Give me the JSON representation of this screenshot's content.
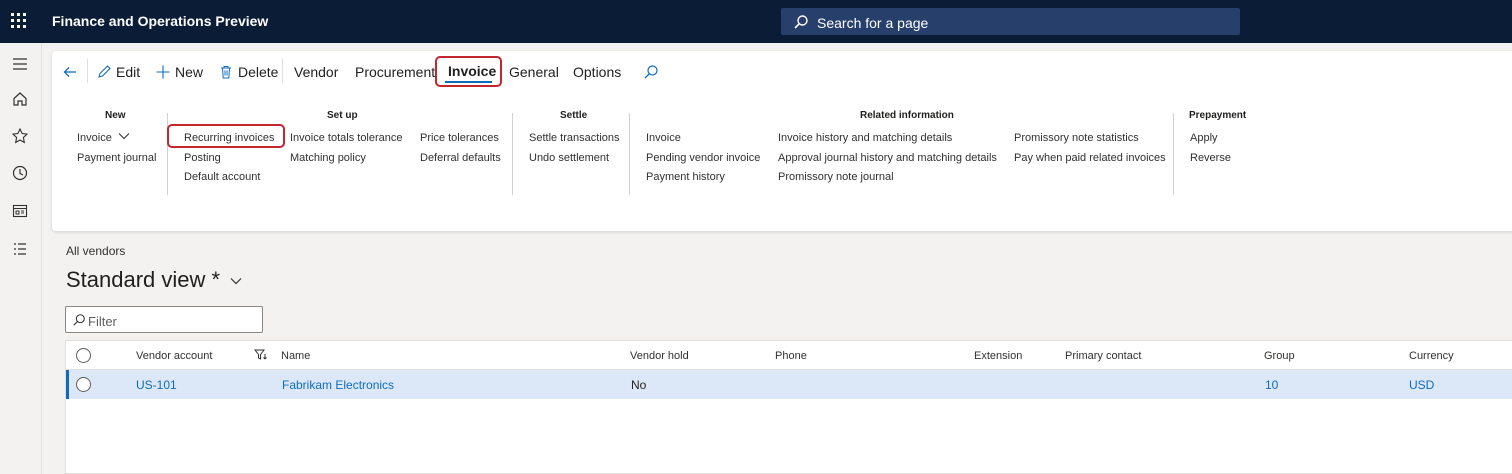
{
  "app": {
    "title": "Finance and Operations Preview"
  },
  "search": {
    "placeholder": "Search for a page"
  },
  "toolbar": {
    "edit": "Edit",
    "new": "New",
    "delete": "Delete",
    "tabs": [
      "Vendor",
      "Procurement",
      "Invoice",
      "General",
      "Options"
    ]
  },
  "ribbon": {
    "groups": {
      "new": {
        "title": "New",
        "items": [
          "Invoice",
          "Payment journal"
        ]
      },
      "setup": {
        "title": "Set up",
        "items": [
          "Recurring invoices",
          "Posting",
          "Default account",
          "Invoice totals tolerance",
          "Matching policy",
          "Price tolerances",
          "Deferral defaults"
        ]
      },
      "settle": {
        "title": "Settle",
        "items": [
          "Settle transactions",
          "Undo settlement"
        ]
      },
      "related": {
        "title": "Related information",
        "items": [
          "Invoice",
          "Pending vendor invoice",
          "Payment history",
          "Invoice history and matching details",
          "Approval journal history and matching details",
          "Promissory note journal",
          "Promissory note statistics",
          "Pay when paid related invoices"
        ]
      },
      "prepayment": {
        "title": "Prepayment",
        "items": [
          "Apply",
          "Reverse"
        ]
      }
    }
  },
  "page": {
    "breadcrumb": "All vendors",
    "view_title": "Standard view *",
    "filter_placeholder": "Filter"
  },
  "grid": {
    "columns": [
      "Vendor account",
      "Name",
      "Vendor hold",
      "Phone",
      "Extension",
      "Primary contact",
      "Group",
      "Currency"
    ],
    "rows": [
      {
        "vendor_account": "US-101",
        "name": "Fabrikam Electronics",
        "vendor_hold": "No",
        "phone": "",
        "extension": "",
        "primary_contact": "",
        "group": "10",
        "currency": "USD"
      }
    ]
  },
  "colors": {
    "topbar": "#0b1c36",
    "accent": "#0f6cbd",
    "highlight": "#c4262e",
    "selected_row": "#dce8f8"
  }
}
